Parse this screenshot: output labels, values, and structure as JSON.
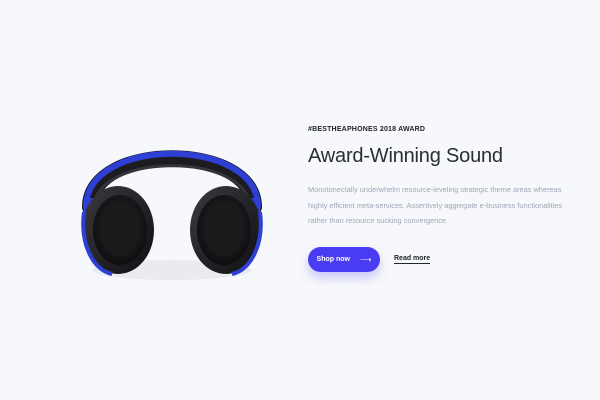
{
  "hero": {
    "eyebrow": "#BESTHEAPHONES 2018 AWARD",
    "title": "Award-Winning Sound",
    "description": "Monotonectally underwhelm resource-leveling strategic theme areas whereas highly efficient meta-services. Assertively aggregate e-business functionalities rather than resource sucking convergence.",
    "primary_button": {
      "label": "Shop now",
      "icon": "arrow-right-icon",
      "glyph": "⟶"
    },
    "secondary_link": "Read more",
    "product_image": "headphones-image"
  },
  "colors": {
    "background": "#f7f8fb",
    "accent": "#4a3cf3",
    "headphone_band": "#2e3fd6",
    "text_dark": "#20232a",
    "text_muted": "#9ea6b7"
  }
}
